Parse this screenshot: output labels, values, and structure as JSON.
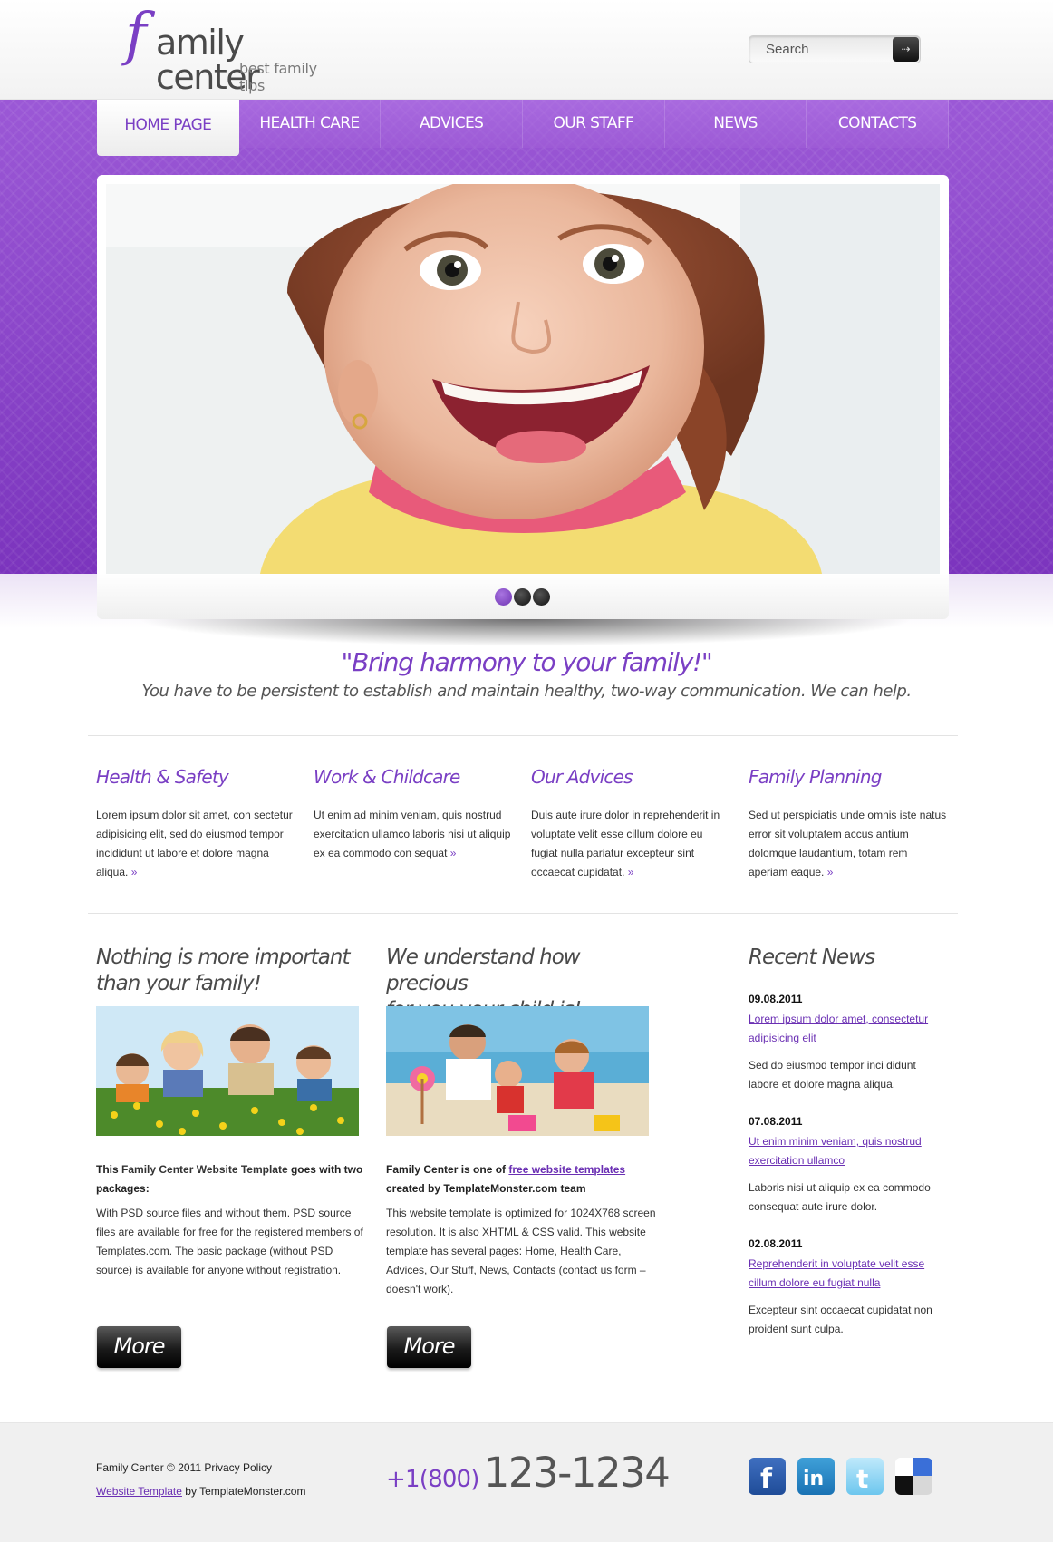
{
  "header": {
    "logo_f": "f",
    "logo_name": "amily center",
    "logo_tagline": "best family tips",
    "search_placeholder": "Search",
    "search_button_icon": "arrow-right-icon"
  },
  "nav": [
    {
      "label": "HOME PAGE",
      "active": true
    },
    {
      "label": "HEALTH CARE"
    },
    {
      "label": "ADVICES"
    },
    {
      "label": "OUR STAFF"
    },
    {
      "label": "NEWS"
    },
    {
      "label": "CONTACTS"
    }
  ],
  "slider": {
    "image": "smiling-girl-photo",
    "dots": 3,
    "active_dot": 1
  },
  "tagline": {
    "title": "\"Bring harmony to your family!\"",
    "subtitle": "You have to be persistent to establish and maintain healthy, two-way communication. We can help."
  },
  "features": [
    {
      "title": "Health & Safety",
      "text": "Lorem ipsum dolor sit amet, con sectetur adipisicing elit, sed do eiusmod tempor incididunt ut labore et dolore magna aliqua."
    },
    {
      "title": "Work & Childcare",
      "text": "Ut enim ad minim veniam, quis nostrud exercitation ullamco laboris nisi ut aliquip ex ea commodo con sequat"
    },
    {
      "title": "Our Advices",
      "text": "Duis aute irure dolor in reprehenderit in voluptate velit esse cillum dolore eu fugiat nulla pariatur excepteur sint occaecat cupidatat."
    },
    {
      "title": "Family Planning",
      "text": "Sed ut perspiciatis unde omnis iste natus error sit voluptatem accus antium dolomque laudantium, totam rem aperiam eaque."
    }
  ],
  "col1": {
    "title_line1": "Nothing is more important",
    "title_line2": "than your family!",
    "lead_a": "This ",
    "lead_b": "Family Center Website Template",
    "lead_c": " goes with two packages:",
    "body": "With PSD source files and without them. PSD source files are available for free for the registered members of Templates.com. The basic package (without PSD source) is available for anyone without registration.",
    "more": "More"
  },
  "col2": {
    "title_line1": "We understand how precious",
    "title_line2": "for you your child is!",
    "lead_a": "Family Center is one of ",
    "lead_link": "free website templates",
    "lead_b": "created by TemplateMonster.com team",
    "body_a": "This website template is optimized for 1024X768 screen resolution. It is also XHTML & CSS valid. This website template has several pages: ",
    "links": [
      "Home",
      "Health Care",
      "Advices",
      "Our Stuff",
      "News",
      "Contacts"
    ],
    "body_b": " (contact us form – doesn't work).",
    "more": "More"
  },
  "news": {
    "title": "Recent News",
    "items": [
      {
        "date": "09.08.2011",
        "link": "Lorem ipsum dolor amet, consectetur adipisicing elit",
        "text": "Sed do eiusmod tempor inci didunt labore et dolore magna aliqua."
      },
      {
        "date": "07.08.2011",
        "link": "Ut enim minim veniam, quis nostrud exercitation ullamco",
        "text": "Laboris nisi ut aliquip ex ea commodo consequat aute irure dolor."
      },
      {
        "date": "02.08.2011",
        "link": "Reprehenderit in voluptate velit esse cillum dolore eu fugiat nulla",
        "text": "Excepteur sint occaecat cupidatat non proident sunt culpa."
      }
    ]
  },
  "footer": {
    "copyright": "Family Center © 2011 Privacy Policy",
    "template_link": "Website Template",
    "by": " by TemplateMonster.com",
    "phone_prefix": "+1(800)",
    "phone_number": "123-1234",
    "social": [
      "facebook-icon",
      "linkedin-icon",
      "twitter-icon",
      "delicious-icon"
    ]
  },
  "colors": {
    "accent": "#7a3fc4",
    "band": "#8a44c8"
  }
}
